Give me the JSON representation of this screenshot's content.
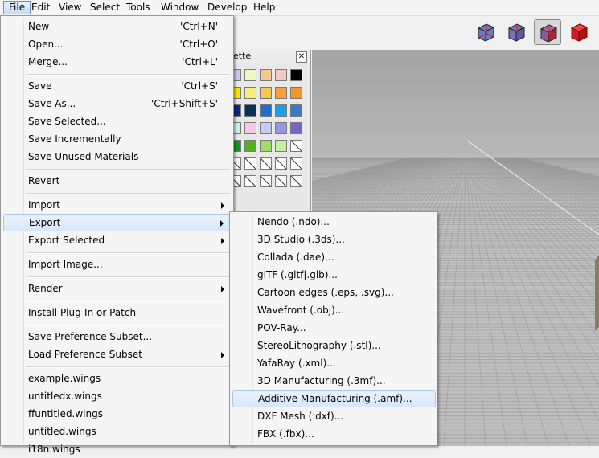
{
  "menubar": {
    "items": [
      {
        "label": "File"
      },
      {
        "label": "Edit"
      },
      {
        "label": "View"
      },
      {
        "label": "Select"
      },
      {
        "label": "Tools"
      },
      {
        "label": "Window"
      },
      {
        "label": "Develop"
      },
      {
        "label": "Help"
      }
    ]
  },
  "toolbar": {
    "buttons": [
      {
        "icon": "wire-cube-icon",
        "color": "#5a6bb0"
      },
      {
        "icon": "shaded-wire-cube-icon",
        "color": "#7a70b5"
      },
      {
        "icon": "smooth-cube-icon",
        "color": "#c02030",
        "pressed": true
      },
      {
        "icon": "red-cube-icon",
        "color": "#d81e1e"
      }
    ]
  },
  "palette": {
    "title": "ette",
    "close_label": "✕",
    "swatches": [
      [
        "#c8c8f0",
        "#f0f5c8",
        "#f5c890",
        "#f5c8c8",
        "#000000"
      ],
      [
        "#f5e600",
        "#f5f07a",
        "#f5c850",
        "#f5a03c",
        "#f59628"
      ],
      [
        "#0a2a7a",
        "#00325a",
        "#1e6ecc",
        "#1ea0e6",
        "#3c78c8"
      ],
      [
        "#c8f0f0",
        "#f5c8e6",
        "#c8c8f5",
        "#9696e6",
        "#7864c8"
      ],
      [
        "#14961e",
        "#50b41e",
        "#a0dc64",
        "#c8f0a0",
        "empty"
      ],
      [
        "empty",
        "empty",
        "empty",
        "empty",
        "empty"
      ],
      [
        "empty",
        "empty",
        "empty",
        "empty",
        "empty"
      ]
    ]
  },
  "file_menu": {
    "items": [
      {
        "label": "New",
        "shortcut": "'Ctrl+N'"
      },
      {
        "label": "Open...",
        "shortcut": "'Ctrl+O'"
      },
      {
        "label": "Merge...",
        "shortcut": "'Ctrl+L'"
      },
      {
        "label": "Save",
        "shortcut": "'Ctrl+S'"
      },
      {
        "label": "Save As...",
        "shortcut": "'Ctrl+Shift+S'"
      },
      {
        "label": "Save Selected..."
      },
      {
        "label": "Save Incrementally"
      },
      {
        "label": "Save Unused Materials"
      },
      {
        "label": "Revert"
      },
      {
        "label": "Import"
      },
      {
        "label": "Export"
      },
      {
        "label": "Export Selected"
      },
      {
        "label": "Import Image..."
      },
      {
        "label": "Render"
      },
      {
        "label": "Install Plug-In or Patch"
      },
      {
        "label": "Save Preference Subset..."
      },
      {
        "label": "Load Preference Subset"
      },
      {
        "label": "example.wings"
      },
      {
        "label": "untitledx.wings"
      },
      {
        "label": "ffuntitled.wings"
      },
      {
        "label": "untitled.wings"
      },
      {
        "label": "i18n.wings"
      }
    ]
  },
  "export_menu": {
    "items": [
      {
        "label": "Nendo (.ndo)..."
      },
      {
        "label": "3D Studio (.3ds)..."
      },
      {
        "label": "Collada (.dae)..."
      },
      {
        "label": "glTF (.gltf|.glb)..."
      },
      {
        "label": "Cartoon edges (.eps, .svg)..."
      },
      {
        "label": "Wavefront (.obj)..."
      },
      {
        "label": "POV-Ray..."
      },
      {
        "label": "StereoLithography (.stl)..."
      },
      {
        "label": "YafaRay (.xml)..."
      },
      {
        "label": "3D Manufacturing (.3mf)..."
      },
      {
        "label": "Additive Manufacturing (.amf)..."
      },
      {
        "label": "DXF Mesh (.dxf)..."
      },
      {
        "label": "FBX (.fbx)..."
      }
    ]
  }
}
